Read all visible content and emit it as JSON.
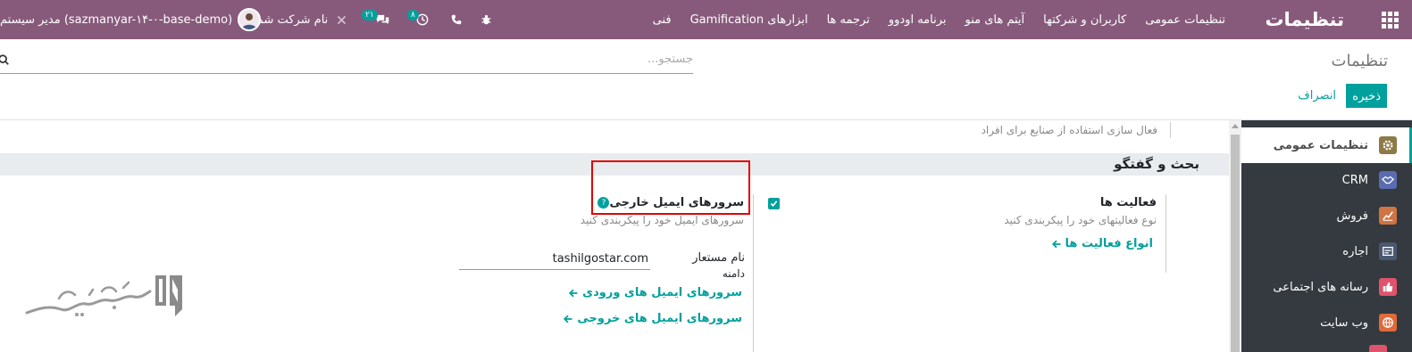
{
  "navbar": {
    "brand": "تنظیمات",
    "menu": [
      "تنظیمات عمومی",
      "کاربران و شرکتها",
      "آیتم های منو",
      "برنامه اودوو",
      "ترجمه ها",
      "ابزارهای Gamification",
      "فنی"
    ],
    "activities_count": "۸",
    "messages_count": "۲۱",
    "company_name": "نام شرکت شما",
    "user_name": "مدیر سیستم (sazmanyar-۱۴-۰-base-demo)"
  },
  "control_panel": {
    "title": "تنظیمات",
    "search_placeholder": "جستجو...",
    "save_label": "ذخیره",
    "discard_label": "انصراف"
  },
  "sidebar": {
    "items": [
      {
        "label": "تنظیمات عمومی",
        "icon": "gear-icon",
        "color": "#8c7a47"
      },
      {
        "label": "CRM",
        "icon": "handshake-icon",
        "color": "#5b6cb0"
      },
      {
        "label": "فروش",
        "icon": "chart-icon",
        "color": "#cf7443"
      },
      {
        "label": "اجاره",
        "icon": "rental-icon",
        "color": "#4a5870"
      },
      {
        "label": "رسانه های اجتماعی",
        "icon": "thumbs-up-icon",
        "color": "#e0536d"
      },
      {
        "label": "وب سایت",
        "icon": "globe-icon",
        "color": "#e06a3a"
      }
    ]
  },
  "content": {
    "previous_setting_desc": "فعال سازی استفاده از صنایع برای افراد",
    "section_title": "بحث و گفتگو",
    "activities": {
      "title": "فعالیت ها",
      "desc": "نوع فعالیتهای خود را پیکربندی کنید",
      "link": "انواع فعالیت ها"
    },
    "external_mail": {
      "title": "سرورهای ایمیل خارجی",
      "desc": "سرورهای ایمیل خود را پیکربندی کنید",
      "alias_label": "نام مستعار",
      "domain_label": "دامنه",
      "domain_value": "tashilgostar.com",
      "incoming_link": "سرورهای ایمیل های ورودی",
      "outgoing_link": "سرورهای ایمیل های خروجی"
    }
  },
  "colors": {
    "navbar": "#875a7b",
    "accent": "#00a09d",
    "sidebar": "#343a40",
    "highlight": "#e30000"
  }
}
